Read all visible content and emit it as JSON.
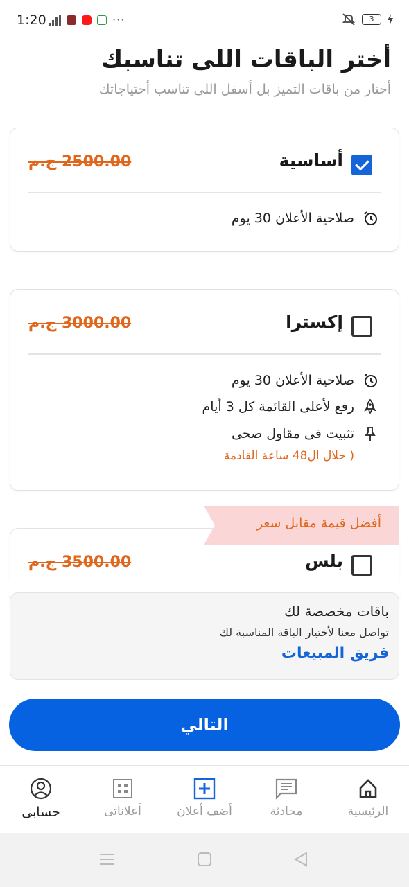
{
  "status_bar": {
    "time": "1:20",
    "battery": "3"
  },
  "header": {
    "title": "أختر الباقات اللى تناسبك",
    "subtitle": "أختار من باقات التميز بل أسفل اللى تناسب أحتياجاتك"
  },
  "packages": [
    {
      "name": "أساسية",
      "price": "2500.00 ج.م",
      "selected": true,
      "features": [
        {
          "icon": "clock-icon",
          "text": "صلاحية الأعلان 30 يوم"
        }
      ]
    },
    {
      "name": "إكسترا",
      "price": "3000.00 ج.م",
      "selected": false,
      "features": [
        {
          "icon": "clock-icon",
          "text": "صلاحية الأعلان 30 يوم"
        },
        {
          "icon": "rocket-icon",
          "text": "رفع لأعلى القائمة كل 3 أيام"
        },
        {
          "icon": "pin-icon",
          "text": "تثبيت فى مقاول صحى",
          "note": "( خلال ال48 ساعة القادمة"
        }
      ]
    },
    {
      "name": "بلس",
      "price": "3500.00 ج.م",
      "selected": false,
      "ribbon": "أفضل قيمة مقابل سعر"
    }
  ],
  "custom": {
    "title": "باقات مخصصة لك",
    "text": "تواصل معنا لأختيار الباقة المناسبة لك",
    "link": "فريق المبيعات"
  },
  "next_button": "التالي",
  "bottom_nav": [
    {
      "label": "حسابى",
      "icon": "account-icon",
      "active": true
    },
    {
      "label": "أعلاناتى",
      "icon": "grid-icon",
      "active": false
    },
    {
      "label": "أضف أعلان",
      "icon": "add-box-icon",
      "active": false
    },
    {
      "label": "محادثة",
      "icon": "chat-icon",
      "active": false
    },
    {
      "label": "الرئيسية",
      "icon": "home-icon",
      "active": false
    }
  ],
  "colors": {
    "primary": "#0662e0",
    "accent": "#e0661c",
    "ribbon_bg": "#fbd6d6"
  }
}
